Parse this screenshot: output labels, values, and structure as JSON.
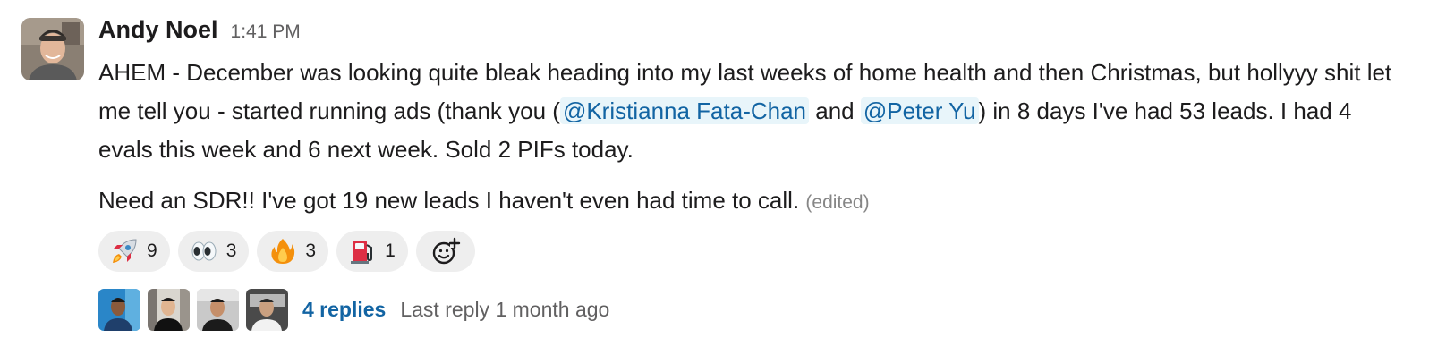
{
  "message": {
    "sender": "Andy Noel",
    "timestamp": "1:41 PM",
    "paragraph1": {
      "part1": "AHEM - December was looking quite bleak heading into my last weeks of home health and then Christmas, but hollyyy shit let me tell you - started running ads (thank you (",
      "mention1": "@Kristianna Fata-Chan",
      "part2": " and ",
      "mention2": "@Peter Yu",
      "part3": ") in 8 days I've had 53 leads. I had 4 evals this week and 6 next week. Sold 2 PIFs today."
    },
    "paragraph2": "Need an SDR!! I've got 19 new leads I haven't even had time to call.",
    "edited_label": "(edited)",
    "colors": {
      "mention_text": "#1264a3",
      "mention_bg": "#e8f5fa",
      "reaction_bg": "#eeeeee"
    }
  },
  "reactions": [
    {
      "icon": "rocket-emoji",
      "count": "9"
    },
    {
      "icon": "eyes-emoji",
      "count": "3"
    },
    {
      "icon": "fire-emoji",
      "count": "3"
    },
    {
      "icon": "fuel-pump-emoji",
      "count": "1"
    }
  ],
  "add_reaction": {
    "icon": "add-reaction-icon"
  },
  "thread": {
    "replies_label": "4 replies",
    "last_reply": "Last reply 1 month ago"
  }
}
